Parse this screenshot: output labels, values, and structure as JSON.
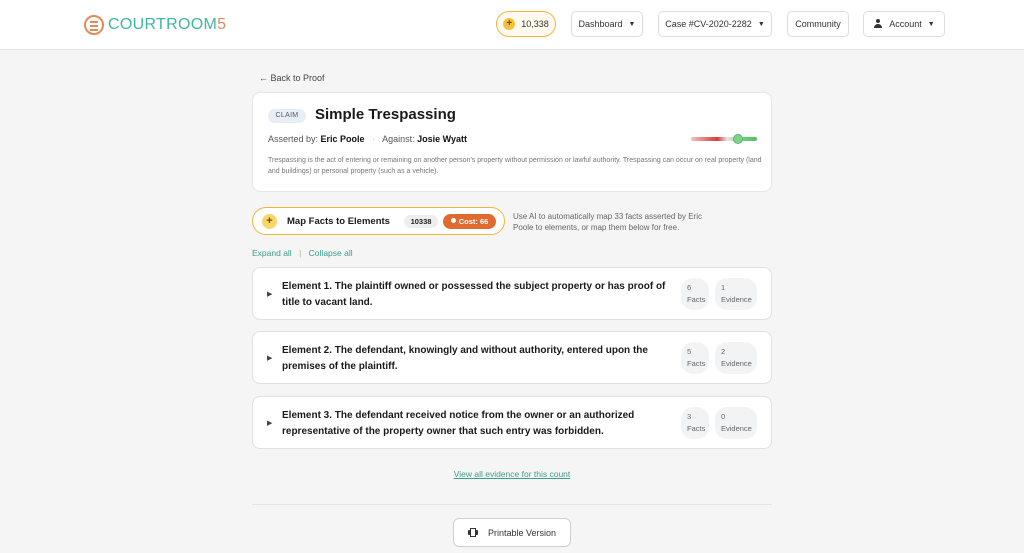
{
  "header": {
    "logo": {
      "part1": "COURTROOM",
      "part2": "5"
    },
    "coins": "10,338",
    "nav": {
      "dashboard": "Dashboard",
      "case": "Case #CV-2020-2282",
      "community": "Community",
      "account": "Account"
    }
  },
  "back_link": "← Back to Proof",
  "claim": {
    "badge": "CLAIM",
    "title": "Simple Trespassing",
    "asserted_label": "Asserted by:",
    "asserted_by": "Eric Poole",
    "against_label": "Against:",
    "against": "Josie Wyatt",
    "strength_fraction": 0.75,
    "description": "Trespassing is the act of entering or remaining on another person's property without permission or lawful authority. Trespassing can occur on real property (land and buildings) or personal property (such as a vehicle)."
  },
  "map_facts": {
    "label": "Map Facts to Elements",
    "count": "10338",
    "cost": "Cost: 66",
    "help": "Use AI to automatically map 33 facts asserted by Eric Poole to elements, or map them below for free."
  },
  "expand_all": "Expand all",
  "collapse_all": "Collapse all",
  "elements": [
    {
      "text": "Element 1. The plaintiff owned or possessed the subject property or has proof of title to vacant land.",
      "facts_count": "6",
      "facts_label": "Facts",
      "evidence_count": "1",
      "evidence_label": "Evidence"
    },
    {
      "text": "Element 2. The defendant, knowingly and without authority, entered upon the premises of the plaintiff.",
      "facts_count": "5",
      "facts_label": "Facts",
      "evidence_count": "2",
      "evidence_label": "Evidence"
    },
    {
      "text": "Element 3. The defendant received notice from the owner or an authorized representative of the property owner that such entry was forbidden.",
      "facts_count": "3",
      "facts_label": "Facts",
      "evidence_count": "0",
      "evidence_label": "Evidence"
    }
  ],
  "view_all": "View all evidence for this count",
  "printable": "Printable Version",
  "icons": {
    "toggle": "▶",
    "caret": "▼",
    "plus": "+"
  }
}
